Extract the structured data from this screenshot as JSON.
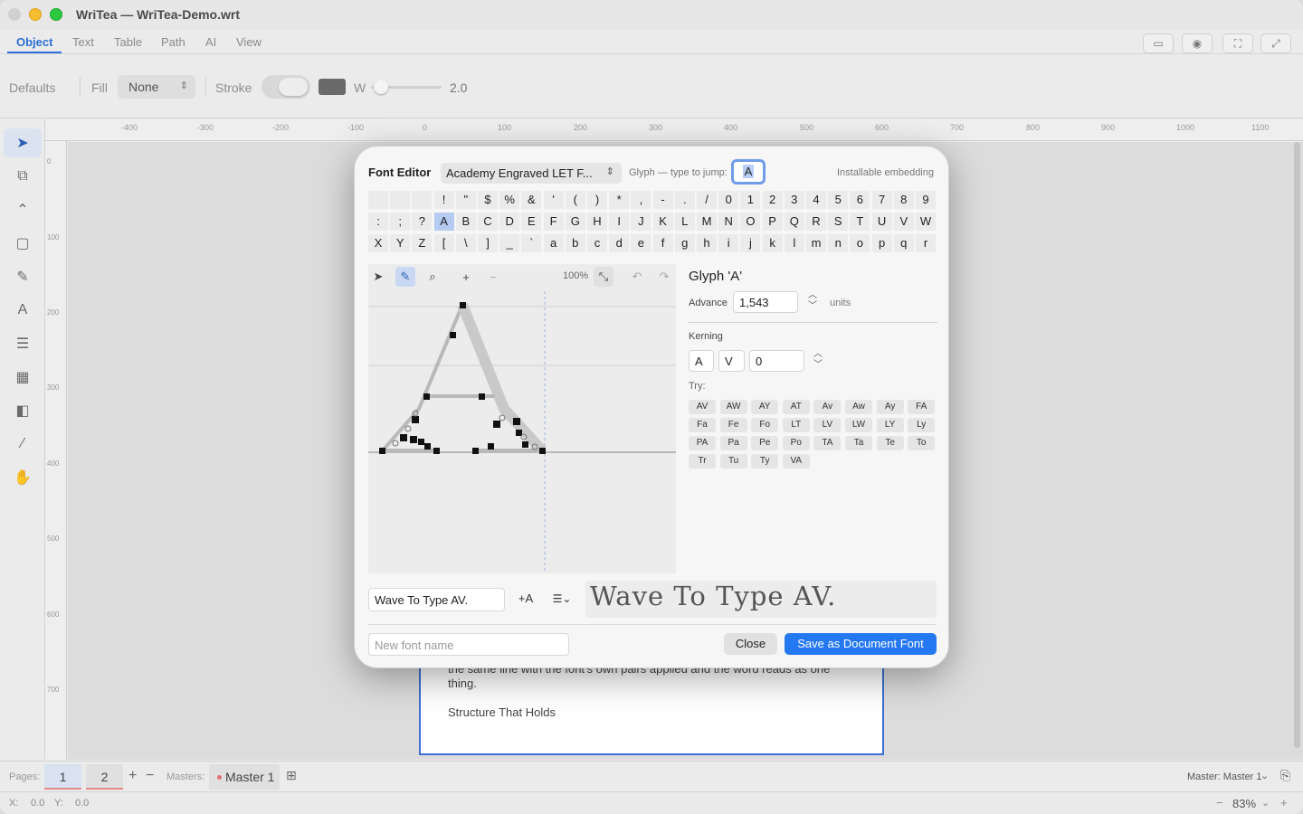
{
  "window": {
    "title": "WriTea — WriTea-Demo.wrt"
  },
  "tabs": [
    {
      "label": "Object",
      "active": true
    },
    {
      "label": "Text"
    },
    {
      "label": "Table"
    },
    {
      "label": "Path"
    },
    {
      "label": "AI"
    },
    {
      "label": "View"
    }
  ],
  "props": {
    "defaults_label": "Defaults",
    "fill_label": "Fill",
    "fill_value": "None",
    "stroke_label": "Stroke",
    "width_label": "W",
    "width_value": "2.0",
    "stroke_color": "#6a6a6a"
  },
  "ruler": {
    "top": [
      "-400",
      "-300",
      "-200",
      "-100",
      "0",
      "100",
      "200",
      "300",
      "400",
      "500",
      "600",
      "700",
      "800",
      "900",
      "1000",
      "1100"
    ],
    "left": [
      "0",
      "100",
      "200",
      "300",
      "400",
      "500",
      "600",
      "700"
    ]
  },
  "page_text": {
    "line1": "the same line with the font's own pairs applied and the word reads as one",
    "line2": "thing.",
    "heading": "Structure That Holds"
  },
  "dialog": {
    "title": "Font Editor",
    "font_name": "Academy Engraved LET F...",
    "jump_label": "Glyph — type to jump:",
    "jump_value": "A",
    "embedding": "Installable embedding",
    "glyphs": [
      " ",
      " ",
      " ",
      "!",
      "\"",
      "$",
      "%",
      "&",
      "'",
      "(",
      ")",
      "*",
      ",",
      "-",
      ".",
      "/",
      "0",
      "1",
      "2",
      "3",
      "4",
      "5",
      "6",
      "7",
      "8",
      "9",
      ":",
      ";",
      "?",
      "A",
      "B",
      "C",
      "D",
      "E",
      "F",
      "G",
      "H",
      "I",
      "J",
      "K",
      "L",
      "M",
      "N",
      "O",
      "P",
      "Q",
      "R",
      "S",
      "T",
      "U",
      "V",
      "W",
      "X",
      "Y",
      "Z",
      "[",
      "\\",
      "]",
      "_",
      "`",
      "a",
      "b",
      "c",
      "d",
      "e",
      "f",
      "g",
      "h",
      "i",
      "j",
      "k",
      "l",
      "m",
      "n",
      "o",
      "p",
      "q",
      "r"
    ],
    "selected_glyph": "A",
    "zoom": "100%",
    "glyph_title": "Glyph 'A'",
    "advance_label": "Advance",
    "advance_value": "1,543",
    "units_label": "units",
    "kerning_label": "Kerning",
    "kern_left": "A",
    "kern_right": "V",
    "kern_value": "0",
    "try_label": "Try:",
    "pairs": [
      "AV",
      "AW",
      "AY",
      "AT",
      "Av",
      "Aw",
      "Ay",
      "FA",
      "Fa",
      "Fe",
      "Fo",
      "LT",
      "LV",
      "LW",
      "LY",
      "Ly",
      "PA",
      "Pa",
      "Pe",
      "Po",
      "TA",
      "Ta",
      "Te",
      "To",
      "Tr",
      "Tu",
      "Ty",
      "VA"
    ],
    "sample_text": "Wave To Type AV.",
    "add_label": "+A",
    "preview_text": "Wave To Type AV.",
    "new_font_placeholder": "New font name",
    "close_label": "Close",
    "save_label": "Save as Document Font",
    "accent": "#2478f2"
  },
  "bottom": {
    "pages_label": "Pages:",
    "pages": [
      "1",
      "2"
    ],
    "masters_label": "Masters:",
    "master_name": "Master 1",
    "master_select": "Master: Master 1"
  },
  "status": {
    "x_label": "X:",
    "x_value": "0.0",
    "y_label": "Y:",
    "y_value": "0.0",
    "zoom": "83%"
  }
}
